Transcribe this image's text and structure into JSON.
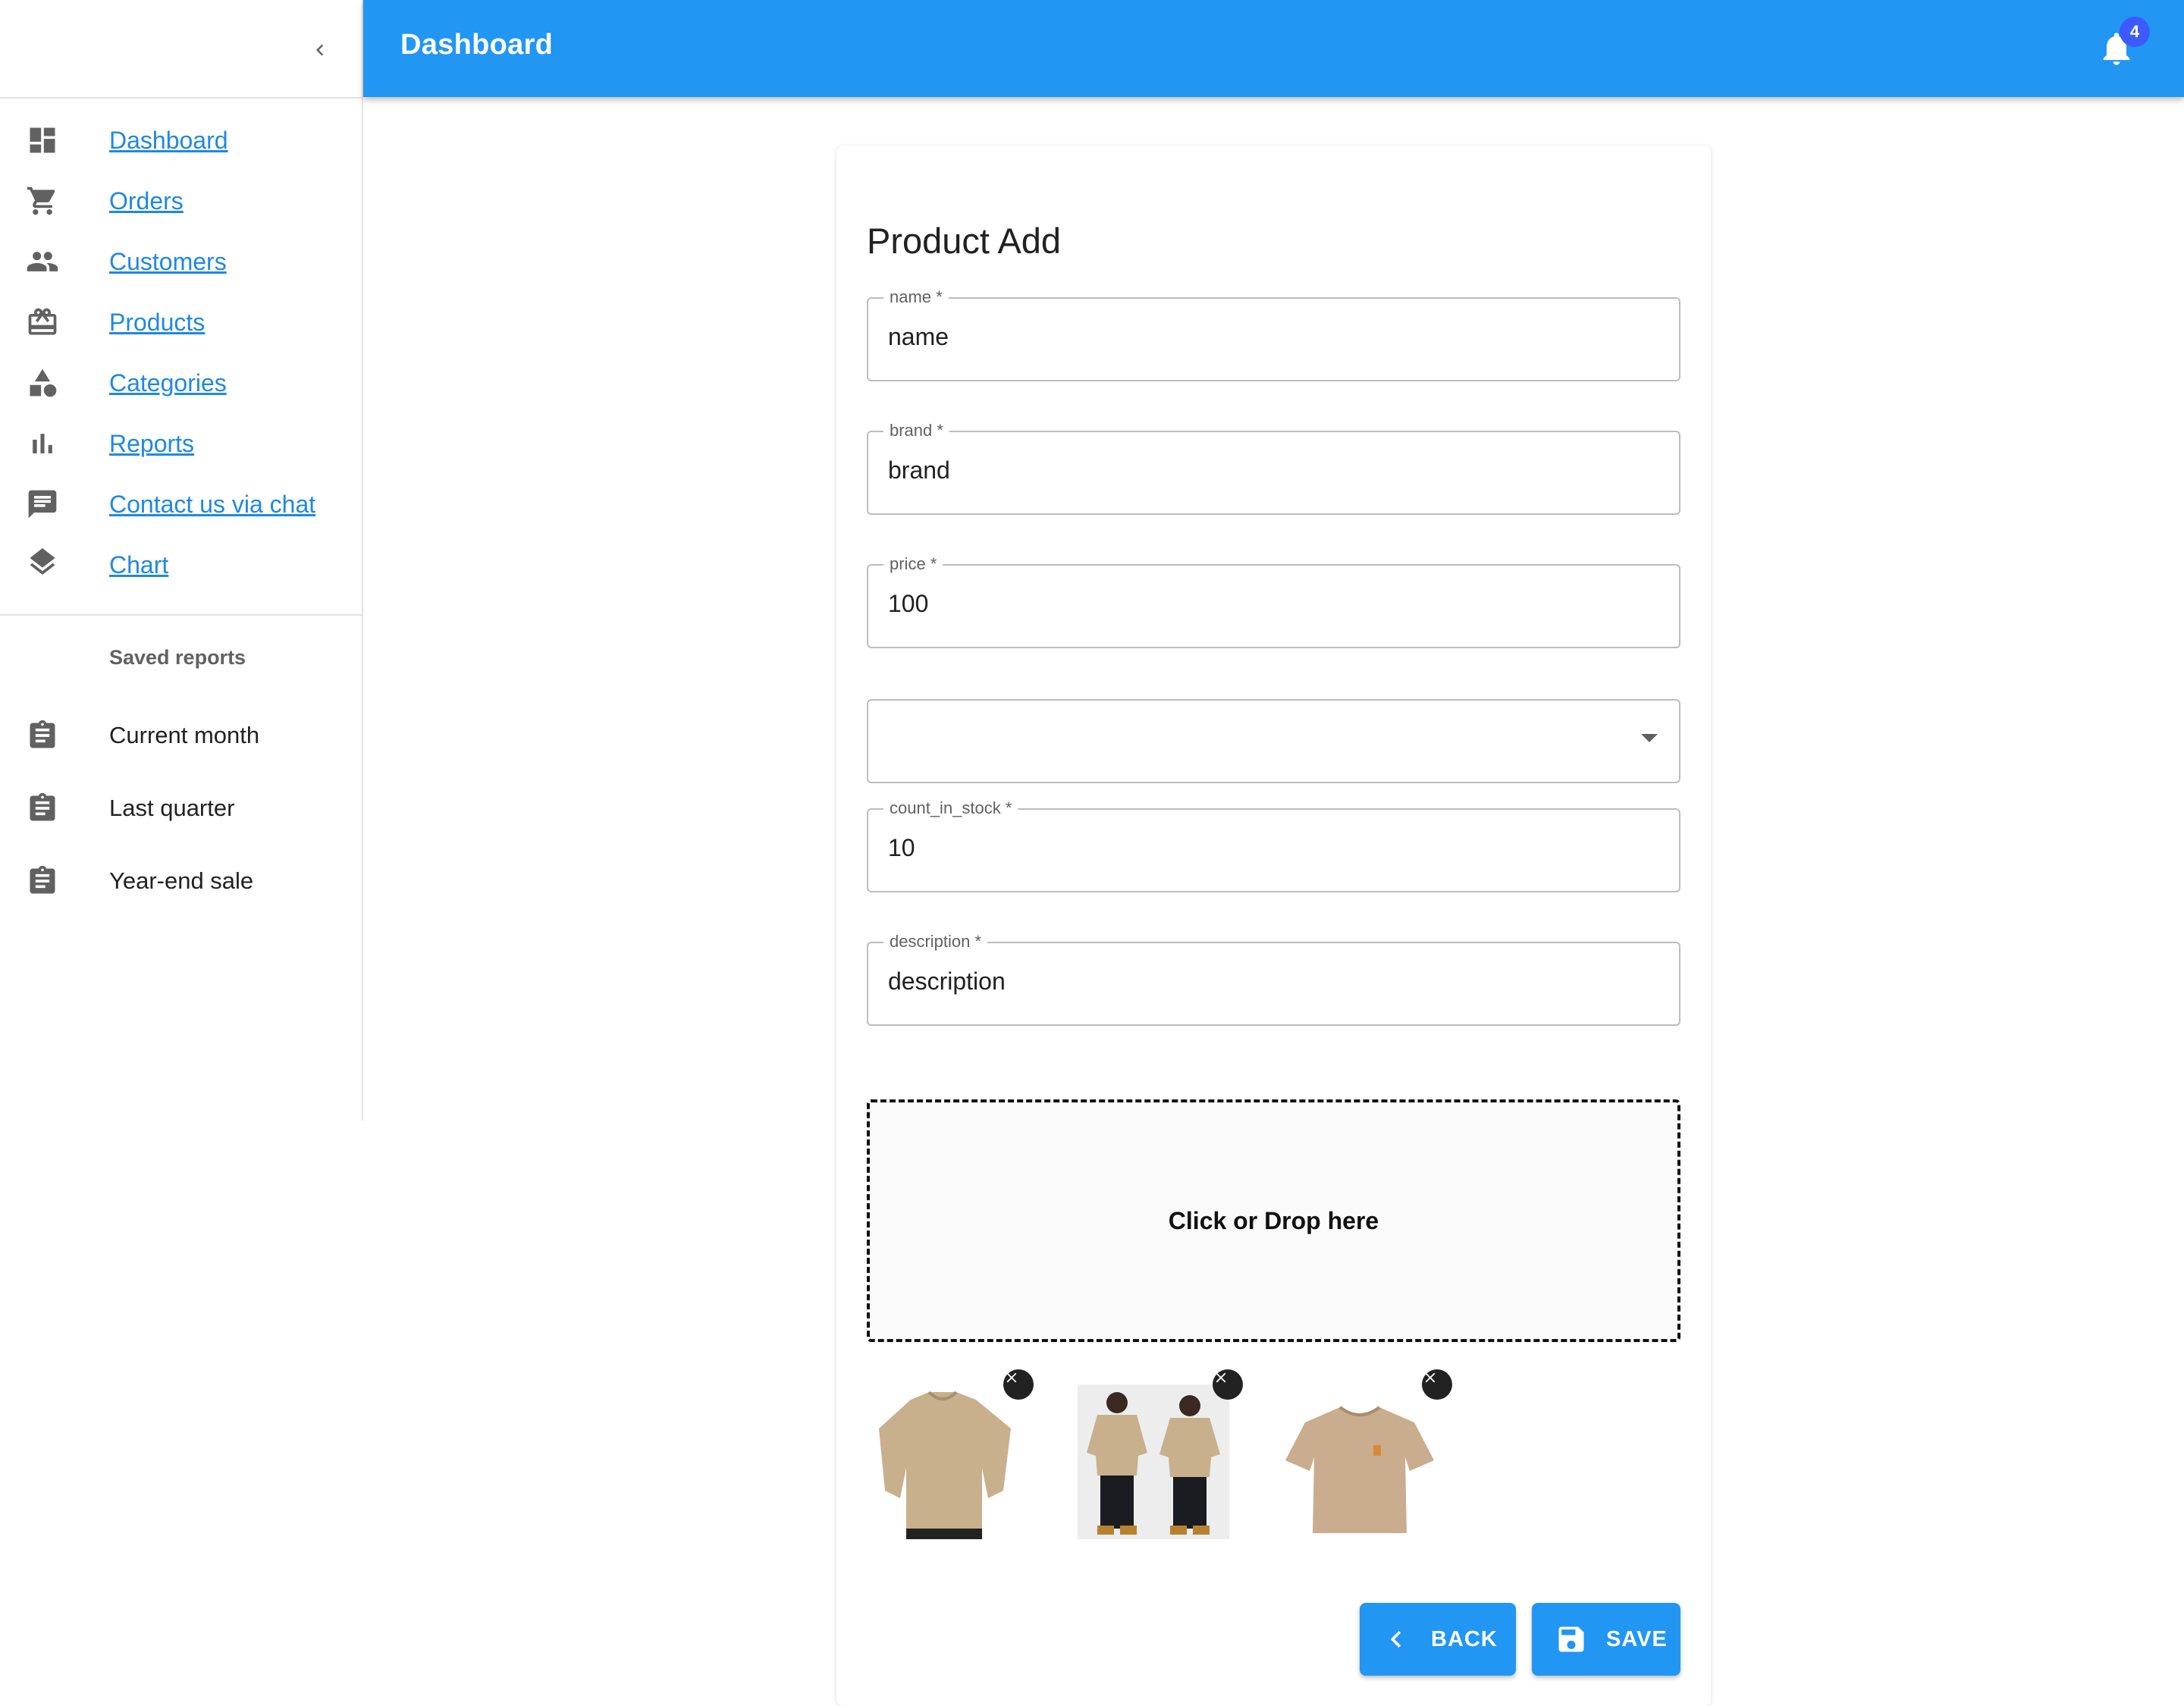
{
  "appbar": {
    "title": "Dashboard",
    "notification_count": "4",
    "bell_icon": "bell-icon"
  },
  "sidebar": {
    "collapse_icon": "chevron-left-icon",
    "items": [
      {
        "label": "Dashboard",
        "icon": "dashboard-icon"
      },
      {
        "label": "Orders",
        "icon": "cart-icon"
      },
      {
        "label": "Customers",
        "icon": "people-icon"
      },
      {
        "label": "Products",
        "icon": "gift-card-icon"
      },
      {
        "label": "Categories",
        "icon": "shapes-icon"
      },
      {
        "label": "Reports",
        "icon": "bar-chart-icon"
      },
      {
        "label": "Contact us via chat",
        "icon": "chat-icon"
      },
      {
        "label": "Chart",
        "icon": "layers-icon"
      }
    ],
    "saved_header": "Saved reports",
    "saved_reports": [
      {
        "label": "Current month",
        "icon": "assignment-icon"
      },
      {
        "label": "Last quarter",
        "icon": "assignment-icon"
      },
      {
        "label": "Year-end sale",
        "icon": "assignment-icon"
      }
    ]
  },
  "form": {
    "title": "Product Add",
    "fields": {
      "name": {
        "label": "name *",
        "value": "name"
      },
      "brand": {
        "label": "brand *",
        "value": "brand"
      },
      "price": {
        "label": "price *",
        "value": "100"
      },
      "category": {
        "value": ""
      },
      "count_in_stock": {
        "label": "count_in_stock *",
        "value": "10"
      },
      "description": {
        "label": "description *",
        "value": "description"
      }
    },
    "dropzone_text": "Click or Drop here",
    "back_label": "BACK",
    "save_label": "SAVE"
  },
  "colors": {
    "primary": "#2196f3",
    "link": "#1e88e5",
    "badge": "#3d5afe",
    "shirt": "#c8b08c"
  }
}
